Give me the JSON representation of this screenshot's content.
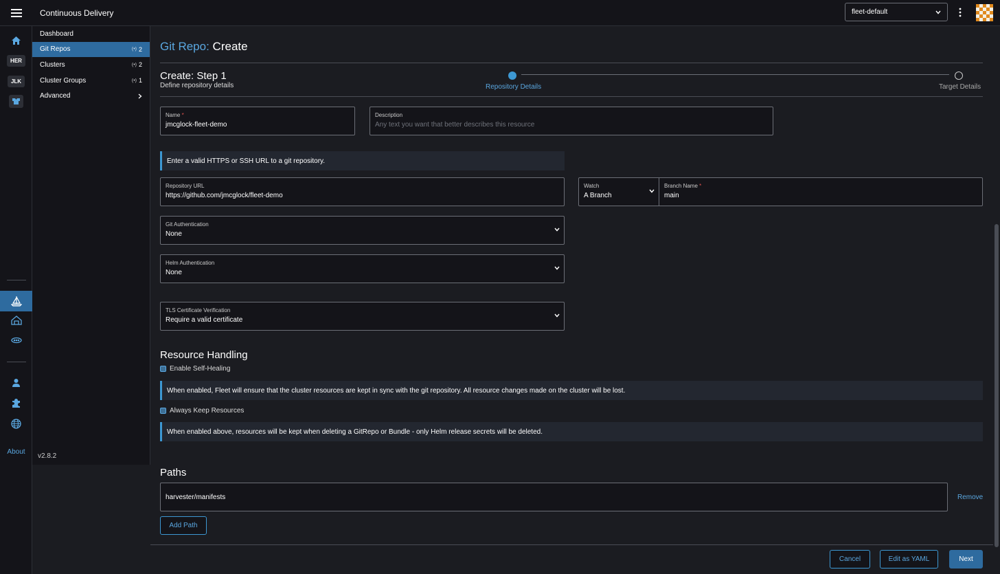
{
  "header": {
    "app_title": "Continuous Delivery",
    "namespace_selected": "fleet-default"
  },
  "rail": {
    "clusters": [
      {
        "label": "HER"
      },
      {
        "label": "JLK"
      }
    ],
    "about_label": "About"
  },
  "sidebar": {
    "items": [
      {
        "label": "Dashboard",
        "count": ""
      },
      {
        "label": "Git Repos",
        "count": "2"
      },
      {
        "label": "Clusters",
        "count": "2"
      },
      {
        "label": "Cluster Groups",
        "count": "1"
      },
      {
        "label": "Advanced",
        "count": ""
      }
    ],
    "version": "v2.8.2"
  },
  "page": {
    "crumb": "Git Repo:",
    "title": "Create",
    "step_title": "Create: Step 1",
    "step_subtitle": "Define repository details",
    "steps": [
      {
        "label": "Repository Details"
      },
      {
        "label": "Target Details"
      }
    ]
  },
  "form": {
    "name": {
      "label": "Name",
      "required": "*",
      "value": "jmcglock-fleet-demo"
    },
    "description": {
      "label": "Description",
      "placeholder": "Any text you want that better describes this resource"
    },
    "url_banner": "Enter a valid HTTPS or SSH URL to a git repository.",
    "repo_url": {
      "label": "Repository URL",
      "value": "https://github.com/jmcglock/fleet-demo"
    },
    "watch": {
      "label": "Watch",
      "value": "A Branch"
    },
    "branch": {
      "label": "Branch Name",
      "required": "*",
      "value": "main"
    },
    "git_auth": {
      "label": "Git Authentication",
      "value": "None"
    },
    "helm_auth": {
      "label": "Helm Authentication",
      "value": "None"
    },
    "tls": {
      "label": "TLS Certificate Verification",
      "value": "Require a valid certificate"
    }
  },
  "resource_handling": {
    "title": "Resource Handling",
    "self_healing_label": "Enable Self-Healing",
    "self_healing_info": "When enabled, Fleet will ensure that the cluster resources are kept in sync with the git repository. All resource changes made on the cluster will be lost.",
    "keep_label": "Always Keep Resources",
    "keep_info": "When enabled above, resources will be kept when deleting a GitRepo or Bundle - only Helm release secrets will be deleted."
  },
  "paths": {
    "title": "Paths",
    "items": [
      "harvester/manifests"
    ],
    "remove_label": "Remove",
    "add_label": "Add Path"
  },
  "footer": {
    "cancel_label": "Cancel",
    "yaml_label": "Edit as YAML",
    "next_label": "Next"
  },
  "colors": {
    "accent": "#3d98d3",
    "active_bg": "#2e6b9f"
  }
}
